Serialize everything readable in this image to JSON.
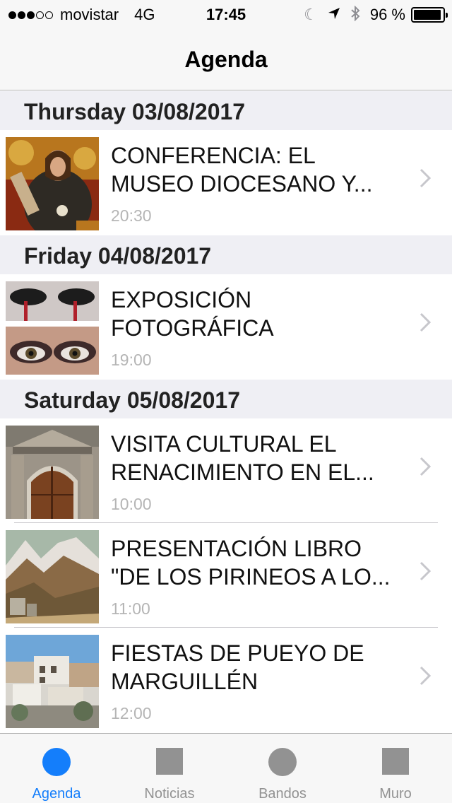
{
  "status_bar": {
    "carrier": "movistar",
    "network": "4G",
    "time": "17:45",
    "battery_percent": "96 %",
    "battery_level": 0.96,
    "signal_bars_filled": 3,
    "signal_bars_total": 5,
    "icons": [
      "moon-icon",
      "location-arrow-icon",
      "bluetooth-icon"
    ]
  },
  "nav": {
    "title": "Agenda"
  },
  "sections": [
    {
      "header": "Thursday 03/08/2017",
      "events": [
        {
          "title": "CONFERENCIA: EL MUSEO DIOCESANO Y...",
          "time": "20:30",
          "thumbnail": "religious-painting"
        }
      ]
    },
    {
      "header": "Friday 04/08/2017",
      "events": [
        {
          "title": "EXPOSICIÓN FOTOGRÁFICA",
          "time": "19:00",
          "thumbnail": "painted-eyes"
        }
      ]
    },
    {
      "header": "Saturday 05/08/2017",
      "events": [
        {
          "title": "VISITA CULTURAL EL RENACIMIENTO EN EL...",
          "time": "10:00",
          "thumbnail": "renaissance-doorway"
        },
        {
          "title": "PRESENTACIÓN LIBRO \"DE LOS PIRINEOS A LO...",
          "time": "11:00",
          "thumbnail": "mountain-painting"
        },
        {
          "title": "FIESTAS DE PUEYO DE MARGUILLÉN",
          "time": "12:00",
          "thumbnail": "village-photo"
        }
      ]
    }
  ],
  "tab_bar": {
    "tabs": [
      {
        "label": "Agenda",
        "icon": "circle-icon",
        "active": true
      },
      {
        "label": "Noticias",
        "icon": "square-icon",
        "active": false
      },
      {
        "label": "Bandos",
        "icon": "circle-icon",
        "active": false
      },
      {
        "label": "Muro",
        "icon": "square-icon",
        "active": false
      }
    ]
  },
  "colors": {
    "accent": "#147efb",
    "inactive_tab": "#929292",
    "section_bg": "#efeff4",
    "time_text": "#b5b5b5"
  }
}
